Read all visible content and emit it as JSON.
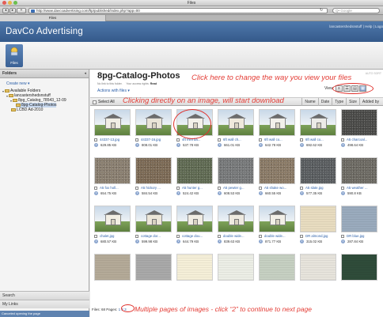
{
  "browser": {
    "window_title": "Files",
    "tab_title": "Files",
    "url": "http://www.davcoadvertising.com/ftp/published/index.php?app=00",
    "search_placeholder": "Q• Google",
    "back_icon": "back-arrow",
    "forward_icon": "forward-arrow",
    "reload_icon": "reload"
  },
  "header": {
    "logo": "DavCo Advertising",
    "links": "lancastershedsnstuff | Help | Logo"
  },
  "toolbar": {
    "files_label": "Files"
  },
  "sidebar": {
    "title": "Folders",
    "create_new": "Create new ▾",
    "tree": [
      {
        "label": "Available Folders"
      },
      {
        "label": "lancastershedsnstuff"
      },
      {
        "label": "8pg_Catalog_78543_12-09"
      },
      {
        "label": "8pg-Catalog-Photos"
      },
      {
        "label": "LCBD Ad-2010"
      }
    ],
    "search_label": "Search",
    "mylinks_label": "My Links",
    "status": "Canceled opening the page"
  },
  "main": {
    "folder_title": "8pg-Catalog-Photos",
    "meta_link": "No link to this folder.",
    "meta_access_label": "Your access rights:",
    "meta_access_value": "Read",
    "top_right_note": "AUTO SORT",
    "actions": "Actions with files ▾",
    "view_label": "View",
    "select_all": "Select All",
    "sort_cols": [
      "Name",
      "Date",
      "Type",
      "Size",
      "Added by"
    ]
  },
  "annotations": {
    "change_view": "Click here to change the way you view your files",
    "click_image": "Clicking directly on an image, will start download",
    "pages": "Multiple pages of images - click “2” to continue to next page"
  },
  "files": [
    {
      "name": "44337-13.jpg",
      "size": "629.85 KB",
      "kind": "shed",
      "color": "#f0ede4"
    },
    {
      "name": "44337-16.jpg",
      "size": "808.01 KB",
      "kind": "shed",
      "color": "#e9e4d7"
    },
    {
      "name": "4ft mini ba...",
      "size": "537.78 KB",
      "kind": "shed",
      "color": "#f4f1ea"
    },
    {
      "name": "6ft wall ch...",
      "size": "661.01 KB",
      "kind": "shed",
      "color": "#efe9dc"
    },
    {
      "name": "6ft wall co...",
      "size": "642.78 KB",
      "kind": "shed",
      "color": "#f2f0ea"
    },
    {
      "name": "6ft wall co...",
      "size": "692.62 KB",
      "kind": "shed",
      "color": "#ecebe7"
    },
    {
      "name": "A5 charcoal...",
      "size": "498.64 KB",
      "kind": "gravel",
      "color": "#4a4a48"
    },
    {
      "name": "A5 fox holl...",
      "size": "654.75 KB",
      "kind": "gravel",
      "color": "#8a7f70"
    },
    {
      "name": "A5 hickory ...",
      "size": "584.54 KB",
      "kind": "gravel",
      "color": "#7c6a55"
    },
    {
      "name": "A5 hunter g...",
      "size": "524.42 KB",
      "kind": "gravel",
      "color": "#5f6a52"
    },
    {
      "name": "A5 pewter g...",
      "size": "608.53 KB",
      "kind": "gravel",
      "color": "#77797a"
    },
    {
      "name": "A5 shake wo...",
      "size": "660.55 KB",
      "kind": "gravel",
      "color": "#8a7a66"
    },
    {
      "name": "A5 slate.jpg",
      "size": "577.35 KB",
      "kind": "gravel",
      "color": "#5a5d60"
    },
    {
      "name": "A5 weather ...",
      "size": "590.8 KB",
      "kind": "gravel",
      "color": "#6d6a63"
    },
    {
      "name": "chalet.jpg",
      "size": "680.57 KB",
      "kind": "shed",
      "color": "#f3efe4"
    },
    {
      "name": "cottage dor...",
      "size": "599.98 KB",
      "kind": "shed",
      "color": "#ece6d8"
    },
    {
      "name": "cottage dou...",
      "size": "644.79 KB",
      "kind": "shed",
      "color": "#f1ede3"
    },
    {
      "name": "double wide...",
      "size": "839.63 KB",
      "kind": "shed",
      "color": "#eeeae0"
    },
    {
      "name": "double wide...",
      "size": "871.77 KB",
      "kind": "shed",
      "color": "#f2efe7"
    },
    {
      "name": "DR almond.jpg",
      "size": "315.02 KB",
      "kind": "swatch",
      "color": "#e8dcc0"
    },
    {
      "name": "DR blue.jpg",
      "size": "287.84 KB",
      "kind": "swatch",
      "color": "#9aabbd"
    },
    {
      "name": "",
      "size": "",
      "kind": "swatch",
      "color": "#b4aa98"
    },
    {
      "name": "",
      "size": "",
      "kind": "swatch",
      "color": "#a9a9a9"
    },
    {
      "name": "",
      "size": "",
      "kind": "swatch",
      "color": "#f5efd8"
    },
    {
      "name": "",
      "size": "",
      "kind": "swatch",
      "color": "#eceee6"
    },
    {
      "name": "",
      "size": "",
      "kind": "swatch",
      "color": "#c6d0c2"
    },
    {
      "name": "",
      "size": "",
      "kind": "swatch",
      "color": "#e7e4dc"
    },
    {
      "name": "",
      "size": "",
      "kind": "swatch",
      "color": "#2f4c3a"
    }
  ],
  "pager": {
    "files_count": "Files: 68",
    "pages_label": "Pages:",
    "pages": [
      "1",
      "2",
      "3"
    ]
  },
  "colors": {
    "accent": "#34598a",
    "annotation": "#e33c35"
  }
}
